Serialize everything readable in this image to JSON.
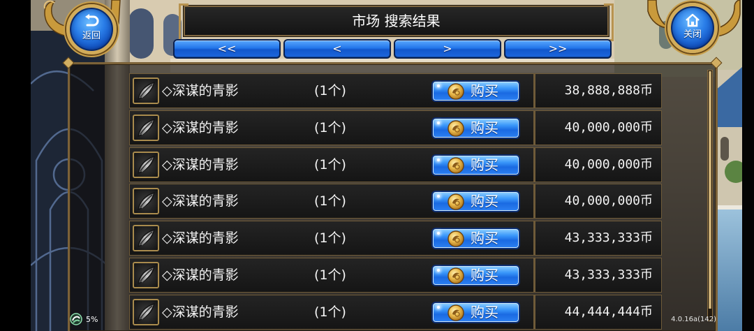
{
  "header": {
    "title": "市场 搜索结果"
  },
  "nav": {
    "back": {
      "label": "返回",
      "icon": "u-turn-arrow-icon"
    },
    "close": {
      "label": "关闭",
      "icon": "house-icon"
    }
  },
  "pagination": [
    {
      "label": "<<"
    },
    {
      "label": "<"
    },
    {
      "label": ">"
    },
    {
      "label": ">>"
    }
  ],
  "listings": [
    {
      "item_name": "◇深谋的青影",
      "quantity": "(1个)",
      "buy_label": "购买",
      "price": "38,888,888币"
    },
    {
      "item_name": "◇深谋的青影",
      "quantity": "(1个)",
      "buy_label": "购买",
      "price": "40,000,000币"
    },
    {
      "item_name": "◇深谋的青影",
      "quantity": "(1个)",
      "buy_label": "购买",
      "price": "40,000,000币"
    },
    {
      "item_name": "◇深谋的青影",
      "quantity": "(1个)",
      "buy_label": "购买",
      "price": "40,000,000币"
    },
    {
      "item_name": "◇深谋的青影",
      "quantity": "(1个)",
      "buy_label": "购买",
      "price": "43,333,333币"
    },
    {
      "item_name": "◇深谋的青影",
      "quantity": "(1个)",
      "buy_label": "购买",
      "price": "43,333,333币"
    },
    {
      "item_name": "◇深谋的青影",
      "quantity": "(1个)",
      "buy_label": "购买",
      "price": "44,444,444币"
    }
  ],
  "status": {
    "indicator": "5%",
    "version": "4.0.16a(142)"
  },
  "icons": {
    "item": "shadow-blade-icon",
    "buy": "coin-icon",
    "status": "swirl-icon"
  },
  "colors": {
    "button_blue": "#1f6fe6",
    "frame_gold": "#b8934f",
    "panel_dark": "#151515",
    "text": "#f4f4f4"
  }
}
